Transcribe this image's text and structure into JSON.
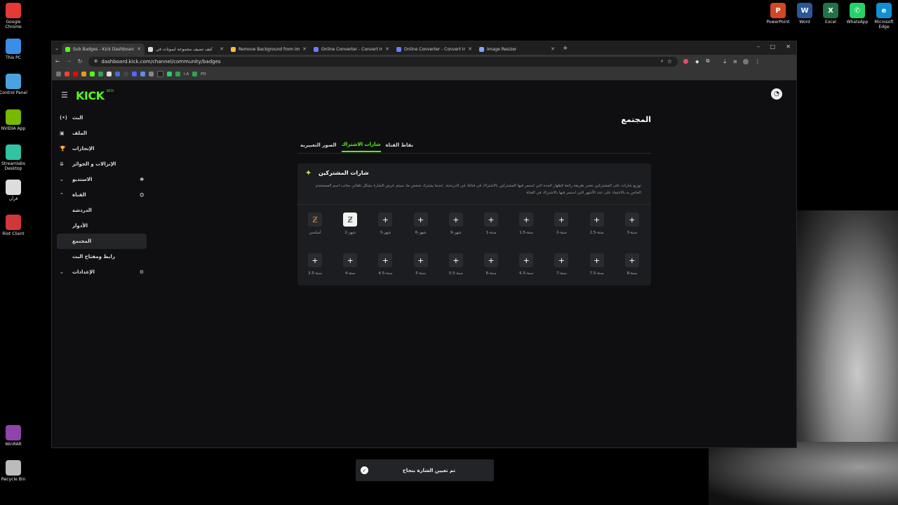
{
  "desktop": {
    "left_icons": [
      {
        "label": "Google Chrome",
        "icon": "chrome-icon",
        "color": "#e53935"
      },
      {
        "label": "This PC",
        "icon": "computer-icon",
        "color": "#3a8ee6"
      },
      {
        "label": "Control Panel",
        "icon": "control-panel-icon",
        "color": "#4aa3df"
      },
      {
        "label": "NVIDIA App",
        "icon": "nvidia-icon",
        "color": "#76b900"
      },
      {
        "label": "Streamlabs Desktop",
        "icon": "streamlabs-icon",
        "color": "#31c3a2"
      },
      {
        "label": "قرآن",
        "icon": "document-icon",
        "color": "#dddddd"
      },
      {
        "label": "Riot Client",
        "icon": "riot-icon",
        "color": "#d13639"
      },
      {
        "label": "WinRAR",
        "icon": "winrar-icon",
        "color": "#8e44ad"
      },
      {
        "label": "Recycle Bin",
        "icon": "recycle-bin-icon",
        "color": "#bbbbbb"
      }
    ],
    "top_icons": [
      {
        "label": "PowerPoint",
        "icon": "powerpoint-icon",
        "color": "#d24726",
        "glyph": "P"
      },
      {
        "label": "Word",
        "icon": "word-icon",
        "color": "#2b579a",
        "glyph": "W"
      },
      {
        "label": "Excel",
        "icon": "excel-icon",
        "color": "#217346",
        "glyph": "X"
      },
      {
        "label": "WhatsApp",
        "icon": "whatsapp-icon",
        "color": "#25d366",
        "glyph": "✆"
      },
      {
        "label": "Microsoft Edge",
        "icon": "edge-icon",
        "color": "#0f8fd6",
        "glyph": "e"
      }
    ]
  },
  "browser": {
    "tabs": [
      {
        "label": "Sub Badges - Kick Dashboard",
        "color": "#53fc18",
        "active": true
      },
      {
        "label": "كيف تضيف مجموعة ايموتات في",
        "color": "#dddddd",
        "active": false
      },
      {
        "label": "Remove Background from Imag",
        "color": "#f4c430",
        "active": false
      },
      {
        "label": "Online Converter - Convert Ima",
        "color": "#6c7cff",
        "active": false
      },
      {
        "label": "Online Converter - Convert Ima",
        "color": "#6c7cff",
        "active": false
      },
      {
        "label": "Image Resizer",
        "color": "#7aa7ff",
        "active": false
      }
    ],
    "url": "dashboard.kick.com/channel/community/badges",
    "bookmarks_text": [
      "I.A",
      "PD"
    ]
  },
  "kick": {
    "logo": "KICK",
    "beta": "BETA",
    "sidebar": [
      {
        "label": "البث",
        "icon": "live-icon",
        "glyph": "(•)",
        "active": false,
        "right": ""
      },
      {
        "label": "الملف",
        "icon": "profile-icon",
        "glyph": "▣",
        "active": false,
        "right": ""
      },
      {
        "label": "الإنجازات",
        "icon": "trophy-icon",
        "glyph": "🏆",
        "active": false,
        "right": ""
      },
      {
        "label": "الإنزالات و الجوائز",
        "icon": "gift-icon",
        "glyph": "⇊",
        "active": false,
        "right": ""
      },
      {
        "label": "الاستديو",
        "icon": "chevron-down-icon",
        "glyph": "⌄",
        "active": false,
        "right": "⛯"
      },
      {
        "label": "القناة",
        "icon": "chevron-up-icon",
        "glyph": "⌃",
        "active": false,
        "right": "⛭"
      },
      {
        "label": "الدردشة",
        "icon": "",
        "glyph": "",
        "active": false,
        "right": ""
      },
      {
        "label": "الأدوار",
        "icon": "",
        "glyph": "",
        "active": false,
        "right": ""
      },
      {
        "label": "المجتمع",
        "icon": "",
        "glyph": "",
        "active": true,
        "right": ""
      },
      {
        "label": "رابط ومفتاح البث",
        "icon": "",
        "glyph": "",
        "active": false,
        "right": ""
      },
      {
        "label": "الإعدادات",
        "icon": "chevron-down-icon",
        "glyph": "⌄",
        "active": false,
        "right": "⚙"
      }
    ],
    "page_title": "المجتمع",
    "tabs": [
      {
        "label": "الصور التعبيرية",
        "active": false
      },
      {
        "label": "شارات الاشتراك",
        "active": true
      },
      {
        "label": "نقاط القناة",
        "active": false
      }
    ],
    "card": {
      "title": "شارات المشتركين",
      "description": "توزيع شارات على المشتركين تختبر طريقة رائعة لإظهار المدة التي استمر فيها المشتركين بالاشتراك في قناتك في الدردشة. عندما يشترك شخص ما، سيتم عرض الشارة بشكل تلقائي بجانب اسم المستخدم الخاص به بالاعتماد على عدد الأشهر التي استمر فيها بالاشتراك في القناة"
    },
    "badges_row1": [
      {
        "label": "أساسي",
        "filled": "orange"
      },
      {
        "label": "شهر-2",
        "filled": "white"
      },
      {
        "label": "شهر-3",
        "filled": ""
      },
      {
        "label": "شهر-6",
        "filled": ""
      },
      {
        "label": "شهر-9",
        "filled": ""
      },
      {
        "label": "سنة-1",
        "filled": ""
      },
      {
        "label": "سنة-1.5",
        "filled": ""
      },
      {
        "label": "سنة-2",
        "filled": ""
      },
      {
        "label": "سنة-2.5",
        "filled": ""
      },
      {
        "label": "سنة-3",
        "filled": ""
      }
    ],
    "badges_row2": [
      {
        "label": "سنة-3.5",
        "filled": ""
      },
      {
        "label": "سنة-4",
        "filled": ""
      },
      {
        "label": "سنة-4.5",
        "filled": ""
      },
      {
        "label": "سنة-5",
        "filled": ""
      },
      {
        "label": "سنة-5.5",
        "filled": ""
      },
      {
        "label": "سنة-6",
        "filled": ""
      },
      {
        "label": "سنة-6.5",
        "filled": ""
      },
      {
        "label": "سنة-7",
        "filled": ""
      },
      {
        "label": "سنة-7.5",
        "filled": ""
      },
      {
        "label": "سنة-8",
        "filled": ""
      }
    ],
    "toast": "تم تعيين الشارة بنجاح"
  }
}
